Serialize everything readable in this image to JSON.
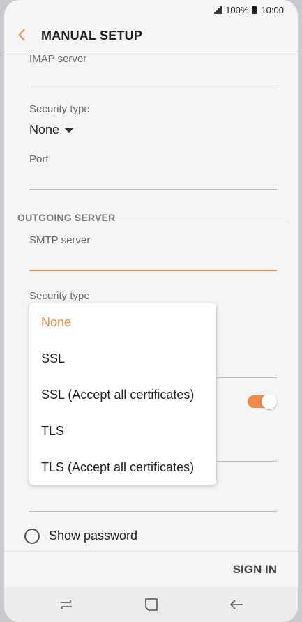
{
  "status": {
    "battery_pct": "100%",
    "time": "10:00"
  },
  "header": {
    "title": "MANUAL SETUP"
  },
  "incoming": {
    "server_label": "IMAP server",
    "security_label": "Security type",
    "security_value": "None",
    "port_label": "Port"
  },
  "outgoing": {
    "section_title": "OUTGOING SERVER",
    "server_label": "SMTP server",
    "security_label": "Security type"
  },
  "dropdown": {
    "options": [
      "None",
      "SSL",
      "SSL (Accept all certificates)",
      "TLS",
      "TLS (Accept all certificates)"
    ],
    "selected": "None"
  },
  "show_password": {
    "label": "Show password"
  },
  "footer": {
    "sign_in": "SIGN IN"
  },
  "colors": {
    "accent": "#f08a4b"
  }
}
